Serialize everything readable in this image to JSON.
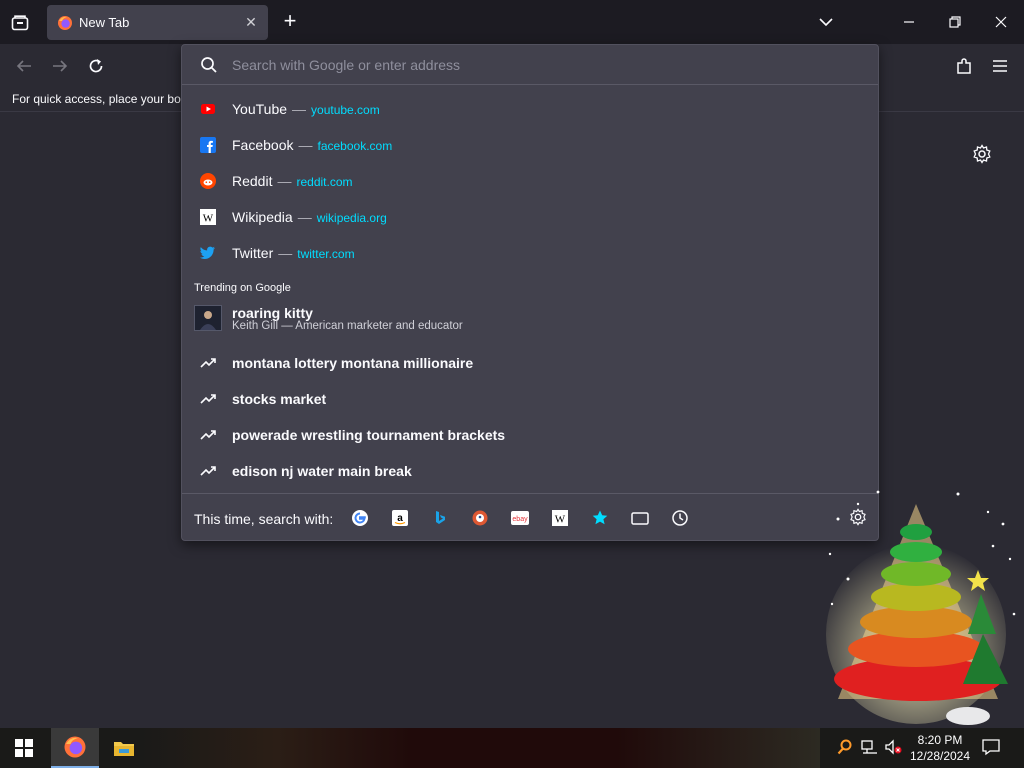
{
  "browser": {
    "tab_title": "New Tab",
    "new_tab_symbol": "+",
    "close_tab_symbol": "✕"
  },
  "bookmarks_bar": {
    "text": "For quick access, place your boo"
  },
  "urlbar": {
    "placeholder": "Search with Google or enter address",
    "value": ""
  },
  "top_sites": [
    {
      "name": "YouTube",
      "separator": "—",
      "url": "youtube.com",
      "icon": "youtube-icon",
      "color": "#ff0000"
    },
    {
      "name": "Facebook",
      "separator": "—",
      "url": "facebook.com",
      "icon": "facebook-icon",
      "color": "#1877f2"
    },
    {
      "name": "Reddit",
      "separator": "—",
      "url": "reddit.com",
      "icon": "reddit-icon",
      "color": "#ff4500"
    },
    {
      "name": "Wikipedia",
      "separator": "—",
      "url": "wikipedia.org",
      "icon": "wikipedia-icon",
      "color": "#ffffff"
    },
    {
      "name": "Twitter",
      "separator": "—",
      "url": "twitter.com",
      "icon": "twitter-icon",
      "color": "#1da1f2"
    }
  ],
  "trending": {
    "label": "Trending on Google",
    "rich_item": {
      "title": "roaring kitty",
      "subtitle": "Keith Gill — American marketer and educator"
    },
    "items": [
      "montana lottery montana millionaire",
      "stocks market",
      "powerade wrestling tournament brackets",
      "edison nj water main break"
    ]
  },
  "one_off": {
    "label": "This time, search with:",
    "engines": [
      "google-icon",
      "amazon-icon",
      "bing-icon",
      "duckduckgo-icon",
      "ebay-icon",
      "wikipedia-icon",
      "bookmarks-star-icon",
      "tabs-icon",
      "history-icon"
    ]
  },
  "taskbar": {
    "time": "8:20 PM",
    "date": "12/28/2024"
  },
  "colors": {
    "accent_url": "#00ddff",
    "panel_bg": "#42414d",
    "window_bg": "#2b2a33",
    "tabbar_bg": "#1c1b22"
  }
}
